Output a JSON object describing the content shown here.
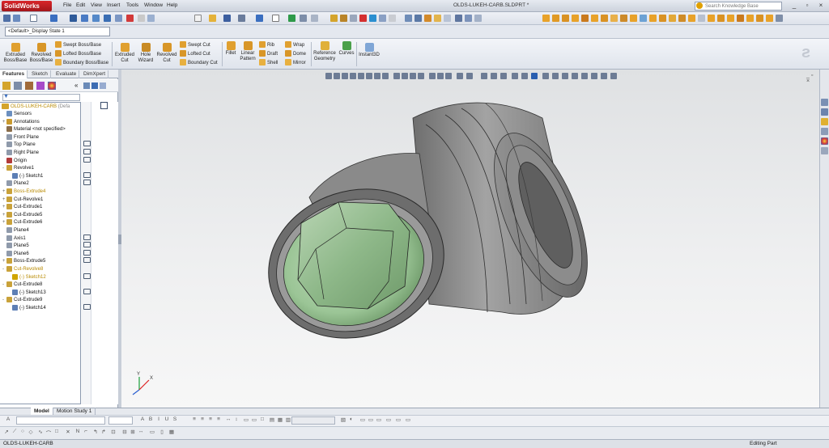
{
  "app": {
    "logo_text": "SolidWorks",
    "menus": [
      "File",
      "Edit",
      "View",
      "Insert",
      "Tools",
      "Window",
      "Help"
    ],
    "document_title": "OLDS-LUKEH-CARB.SLDPRT *",
    "search_placeholder": "Search Knowledge Base",
    "window_buttons": [
      "_",
      "▫",
      "×"
    ]
  },
  "config": {
    "selected": "<Default>_Display State 1"
  },
  "command_manager": {
    "extruded_boss": "Extruded\nBoss/Base",
    "revolved_boss": "Revolved\nBoss/Base",
    "swept_boss": "Swept Boss/Base",
    "lofted_boss": "Lofted Boss/Base",
    "boundary_boss": "Boundary Boss/Base",
    "extruded_cut": "Extruded\nCut",
    "hole_wizard": "Hole\nWizard",
    "revolved_cut": "Revolved\nCut",
    "swept_cut": "Swept Cut",
    "lofted_cut": "Lofted Cut",
    "boundary_cut": "Boundary Cut",
    "fillet": "Fillet",
    "linear_pattern": "Linear\nPattern",
    "rib": "Rib",
    "draft": "Draft",
    "shell": "Shell",
    "wrap": "Wrap",
    "dome": "Dome",
    "mirror": "Mirror",
    "reference_geometry": "Reference\nGeometry",
    "curves": "Curves",
    "instant3d": "Instant3D"
  },
  "panel_tabs": [
    "Features",
    "Sketch",
    "Evaluate",
    "DimXpert"
  ],
  "tree": {
    "root": "OLDS-LUKEH-CARB",
    "root_suffix": "(Defa",
    "items": [
      {
        "label": "Sensors",
        "indent": 1,
        "icon": "#6b8fbf",
        "state": "normal"
      },
      {
        "label": "Annotations",
        "indent": 1,
        "icon": "#c99a2e",
        "state": "normal",
        "exp": "+"
      },
      {
        "label": "Material <not specified>",
        "indent": 1,
        "icon": "#8a6d4a",
        "state": "normal"
      },
      {
        "label": "Front Plane",
        "indent": 1,
        "icon": "#8f9aab",
        "state": "normal"
      },
      {
        "label": "Top Plane",
        "indent": 1,
        "icon": "#8f9aab",
        "state": "normal"
      },
      {
        "label": "Right Plane",
        "indent": 1,
        "icon": "#8f9aab",
        "state": "normal"
      },
      {
        "label": "Origin",
        "indent": 1,
        "icon": "#b23a3a",
        "state": "normal"
      },
      {
        "label": "Revolve1",
        "indent": 1,
        "icon": "#c9a23a",
        "state": "normal",
        "exp": "-"
      },
      {
        "label": "(-) Sketch1",
        "indent": 2,
        "icon": "#5d7fb5",
        "state": "normal"
      },
      {
        "label": "Plane2",
        "indent": 1,
        "icon": "#8f9aab",
        "state": "normal"
      },
      {
        "label": "Boss-Extrude4",
        "indent": 1,
        "icon": "#c9a23a",
        "state": "warn",
        "exp": "+"
      },
      {
        "label": "Cut-Revolve1",
        "indent": 1,
        "icon": "#c9a23a",
        "state": "normal",
        "exp": "+"
      },
      {
        "label": "Cut-Extrude1",
        "indent": 1,
        "icon": "#c9a23a",
        "state": "normal",
        "exp": "+"
      },
      {
        "label": "Cut-Extrude5",
        "indent": 1,
        "icon": "#c9a23a",
        "state": "normal",
        "exp": "+"
      },
      {
        "label": "Cut-Extrude6",
        "indent": 1,
        "icon": "#c9a23a",
        "state": "normal",
        "exp": "+"
      },
      {
        "label": "Plane4",
        "indent": 1,
        "icon": "#8f9aab",
        "state": "normal"
      },
      {
        "label": "Axis1",
        "indent": 1,
        "icon": "#8f9aab",
        "state": "normal"
      },
      {
        "label": "Plane5",
        "indent": 1,
        "icon": "#8f9aab",
        "state": "normal"
      },
      {
        "label": "Plane6",
        "indent": 1,
        "icon": "#8f9aab",
        "state": "normal"
      },
      {
        "label": "Boss-Extrude5",
        "indent": 1,
        "icon": "#c9a23a",
        "state": "normal",
        "exp": "+"
      },
      {
        "label": "Cut-Revolve8",
        "indent": 1,
        "icon": "#c9a23a",
        "state": "warn",
        "exp": "-"
      },
      {
        "label": "(-) Sketch12",
        "indent": 2,
        "icon": "#d0a500",
        "state": "warn"
      },
      {
        "label": "Cut-Extrude8",
        "indent": 1,
        "icon": "#c9a23a",
        "state": "normal",
        "exp": "-"
      },
      {
        "label": "(-) Sketch13",
        "indent": 2,
        "icon": "#5d7fb5",
        "state": "normal"
      },
      {
        "label": "Cut-Extrude9",
        "indent": 1,
        "icon": "#c9a23a",
        "state": "normal",
        "exp": "-"
      },
      {
        "label": "(-) Sketch14",
        "indent": 2,
        "icon": "#5d7fb5",
        "state": "normal"
      }
    ]
  },
  "bottom_tabs": [
    "Model",
    "Motion Study 1"
  ],
  "status": {
    "left": "OLDS-LUKEH-CARB",
    "right": "Editing Part"
  },
  "triad": {
    "x": "X",
    "y": "Y"
  },
  "colors": {
    "accent": "#d8262b",
    "part_gray": "#8c8c8c",
    "interior_green": "#9bc596",
    "warning": "#b88a00"
  }
}
